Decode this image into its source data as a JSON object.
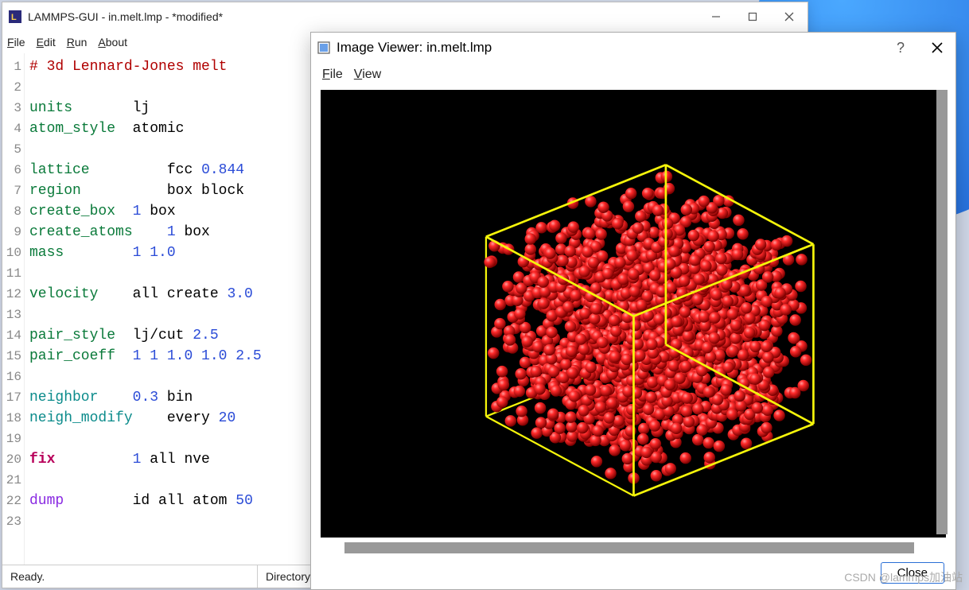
{
  "main_window": {
    "title": "LAMMPS-GUI - in.melt.lmp - *modified*",
    "menu": {
      "file": "File",
      "edit": "Edit",
      "run": "Run",
      "about": "About"
    },
    "status": {
      "ready": "Ready.",
      "directory": "Directory"
    }
  },
  "editor": {
    "lines": [
      {
        "n": "1",
        "seg": [
          {
            "cls": "c-cmt",
            "t": "# 3d Lennard-Jones melt"
          }
        ]
      },
      {
        "n": "2",
        "seg": [
          {
            "cls": "",
            "t": ""
          }
        ]
      },
      {
        "n": "3",
        "seg": [
          {
            "cls": "c-kw",
            "t": "units"
          },
          {
            "cls": "",
            "t": "       lj"
          }
        ]
      },
      {
        "n": "4",
        "seg": [
          {
            "cls": "c-kw",
            "t": "atom_style"
          },
          {
            "cls": "",
            "t": "  atomic"
          }
        ]
      },
      {
        "n": "5",
        "seg": [
          {
            "cls": "",
            "t": ""
          }
        ]
      },
      {
        "n": "6",
        "seg": [
          {
            "cls": "c-kw",
            "t": "lattice"
          },
          {
            "cls": "",
            "t": "         fcc "
          },
          {
            "cls": "c-num",
            "t": "0.844"
          }
        ]
      },
      {
        "n": "7",
        "seg": [
          {
            "cls": "c-kw",
            "t": "region"
          },
          {
            "cls": "",
            "t": "          box block"
          }
        ]
      },
      {
        "n": "8",
        "seg": [
          {
            "cls": "c-kw",
            "t": "create_box"
          },
          {
            "cls": "",
            "t": "  "
          },
          {
            "cls": "c-num",
            "t": "1"
          },
          {
            "cls": "",
            "t": " box"
          }
        ]
      },
      {
        "n": "9",
        "seg": [
          {
            "cls": "c-kw",
            "t": "create_atoms"
          },
          {
            "cls": "",
            "t": "    "
          },
          {
            "cls": "c-num",
            "t": "1"
          },
          {
            "cls": "",
            "t": " box"
          }
        ]
      },
      {
        "n": "10",
        "seg": [
          {
            "cls": "c-kw",
            "t": "mass"
          },
          {
            "cls": "",
            "t": "        "
          },
          {
            "cls": "c-num",
            "t": "1 1.0"
          }
        ]
      },
      {
        "n": "11",
        "seg": [
          {
            "cls": "",
            "t": ""
          }
        ]
      },
      {
        "n": "12",
        "seg": [
          {
            "cls": "c-kw",
            "t": "velocity"
          },
          {
            "cls": "",
            "t": "    all create "
          },
          {
            "cls": "c-num",
            "t": "3.0"
          }
        ]
      },
      {
        "n": "13",
        "seg": [
          {
            "cls": "",
            "t": ""
          }
        ]
      },
      {
        "n": "14",
        "seg": [
          {
            "cls": "c-kw",
            "t": "pair_style"
          },
          {
            "cls": "",
            "t": "  lj/cut "
          },
          {
            "cls": "c-num",
            "t": "2.5"
          }
        ]
      },
      {
        "n": "15",
        "seg": [
          {
            "cls": "c-kw",
            "t": "pair_coeff"
          },
          {
            "cls": "",
            "t": "  "
          },
          {
            "cls": "c-num",
            "t": "1 1 1.0 1.0 2.5"
          }
        ]
      },
      {
        "n": "16",
        "seg": [
          {
            "cls": "",
            "t": ""
          }
        ]
      },
      {
        "n": "17",
        "seg": [
          {
            "cls": "c-tealkw",
            "t": "neighbor"
          },
          {
            "cls": "",
            "t": "    "
          },
          {
            "cls": "c-num",
            "t": "0.3"
          },
          {
            "cls": "",
            "t": " bin"
          }
        ]
      },
      {
        "n": "18",
        "seg": [
          {
            "cls": "c-tealkw",
            "t": "neigh_modify"
          },
          {
            "cls": "",
            "t": "    every "
          },
          {
            "cls": "c-num",
            "t": "20"
          }
        ]
      },
      {
        "n": "19",
        "seg": [
          {
            "cls": "",
            "t": ""
          }
        ]
      },
      {
        "n": "20",
        "seg": [
          {
            "cls": "c-fix",
            "t": "fix"
          },
          {
            "cls": "",
            "t": "         "
          },
          {
            "cls": "c-num",
            "t": "1"
          },
          {
            "cls": "",
            "t": " all nve"
          }
        ]
      },
      {
        "n": "21",
        "seg": [
          {
            "cls": "",
            "t": ""
          }
        ]
      },
      {
        "n": "22",
        "seg": [
          {
            "cls": "c-dump",
            "t": "dump"
          },
          {
            "cls": "",
            "t": "        id all atom "
          },
          {
            "cls": "c-num",
            "t": "50"
          }
        ]
      },
      {
        "n": "23",
        "seg": [
          {
            "cls": "",
            "t": ""
          }
        ]
      }
    ]
  },
  "viewer": {
    "title": "Image Viewer: in.melt.lmp",
    "menu": {
      "file": "File",
      "view": "View"
    },
    "close": "Close",
    "help": "?"
  },
  "watermark": "CSDN @lammps加油站"
}
